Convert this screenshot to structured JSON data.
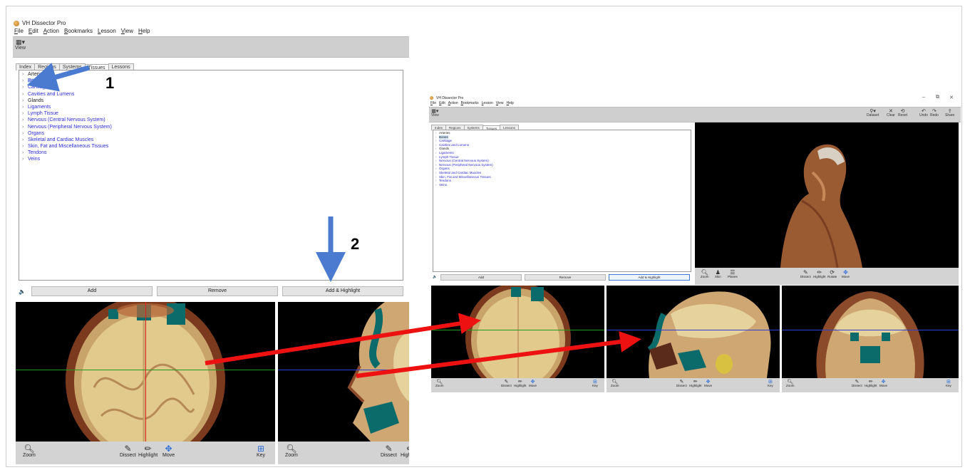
{
  "app": {
    "title": "VH Dissector Pro"
  },
  "menu": [
    "File",
    "Edit",
    "Action",
    "Bookmarks",
    "Lesson",
    "View",
    "Help"
  ],
  "toolbar": {
    "view": "View",
    "dataset": "Dataset",
    "clear": "Clear",
    "reset": "Reset",
    "undo": "Undo",
    "redo": "Redo",
    "share": "Share"
  },
  "tabs": [
    "Index",
    "Regions",
    "Systems",
    "Tissues",
    "Lessons"
  ],
  "tree": [
    "Arteries",
    "Bones",
    "Cartilage",
    "Cavities and Lumens",
    "Glands",
    "Ligaments",
    "Lymph Tissue",
    "Nervous (Central Nervous System)",
    "Nervous (Peripheral Nervous System)",
    "Organs",
    "Skeletal and Cardiac Muscles",
    "Skin, Fat and Miscellaneous Tissues",
    "Tendons",
    "Veins"
  ],
  "buttons": {
    "add": "Add",
    "remove": "Remove",
    "add_highlight": "Add & Highlight"
  },
  "pane_tools": {
    "zoom": "Zoom",
    "dissect": "Dissect",
    "highlight": "Highlight",
    "move": "Move",
    "key": "Key",
    "skin": "Skin",
    "planes": "Planes",
    "rotate": "Rotate"
  },
  "annotations": {
    "step1": "1",
    "step2": "2"
  },
  "window_controls": {
    "minimize": "–",
    "maximize": "⧉",
    "close": "✕"
  },
  "colors": {
    "arrow_blue": "#4a7bd0",
    "arrow_red": "#ee1111",
    "crosshair_red": "#e02020",
    "crosshair_green": "#1e9a1e",
    "crosshair_blue": "#2a3fd8",
    "link_text": "#2d2dd6"
  }
}
